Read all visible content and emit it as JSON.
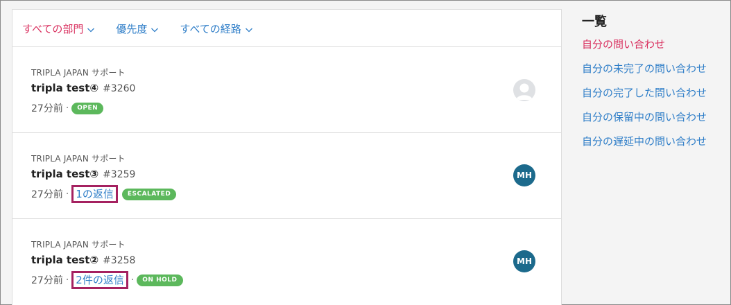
{
  "filters": [
    {
      "label": "すべての部門",
      "active": true
    },
    {
      "label": "優先度",
      "active": false
    },
    {
      "label": "すべての経路",
      "active": false
    }
  ],
  "tickets": [
    {
      "org": "TRIPLA JAPAN サポート",
      "title": "tripla test④",
      "number": "#3260",
      "time": "27分前",
      "replies": "",
      "status": "OPEN",
      "avatar": "",
      "avatar_type": "blank"
    },
    {
      "org": "TRIPLA JAPAN サポート",
      "title": "tripla test③",
      "number": "#3259",
      "time": "27分前",
      "replies": "1の返信",
      "status": "ESCALATED",
      "avatar": "MH",
      "avatar_type": "initials"
    },
    {
      "org": "TRIPLA JAPAN サポート",
      "title": "tripla test②",
      "number": "#3258",
      "time": "27分前",
      "replies": "2件の返信",
      "status": "ON HOLD",
      "avatar": "MH",
      "avatar_type": "initials"
    }
  ],
  "sidebar": {
    "title": "一覧",
    "items": [
      {
        "label": "自分の問い合わせ",
        "active": true
      },
      {
        "label": "自分の未完了の問い合わせ",
        "active": false
      },
      {
        "label": "自分の完了した問い合わせ",
        "active": false
      },
      {
        "label": "自分の保留中の問い合わせ",
        "active": false
      },
      {
        "label": "自分の遅延中の問い合わせ",
        "active": false
      }
    ]
  },
  "colors": {
    "accent_pink": "#d9305f",
    "link_blue": "#2f7ec8",
    "status_green": "#5cb85c",
    "highlight_box": "#a52160",
    "avatar_blue": "#1c6a8c"
  },
  "icons": {
    "filter_chevron": "chevron-down-icon",
    "blank_avatar": "user-silhouette-icon"
  },
  "dot_separator": "·"
}
